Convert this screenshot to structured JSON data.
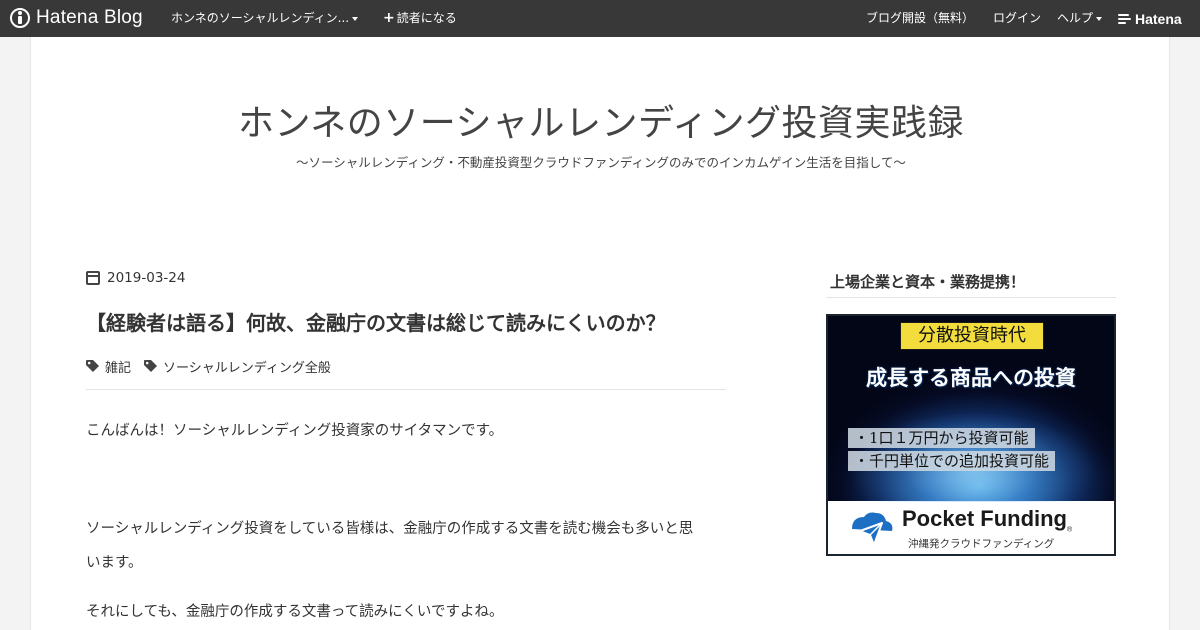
{
  "topbar": {
    "logo_text": "Hatena Blog",
    "blog_menu_label": "ホンネのソーシャルレンディン...",
    "subscribe_label": "読者になる",
    "open_blog_label": "ブログ開設（無料）",
    "login_label": "ログイン",
    "help_label": "ヘルプ",
    "hatena_label": "Hatena"
  },
  "blog": {
    "title": "ホンネのソーシャルレンディング投資実践録",
    "description": "～ソーシャルレンディング・不動産投資型クラウドファンディングのみでのインカムゲイン生活を目指して～"
  },
  "entry": {
    "date": "2019-03-24",
    "title": "【経験者は語る】何故、金融庁の文書は総じて読みにくいのか？",
    "categories": [
      "雑記",
      "ソーシャルレンディング全般"
    ],
    "paragraphs": [
      "こんばんは！ソーシャルレンディング投資家のサイタマンです。",
      "ソーシャルレンディング投資をしている皆様は、金融庁の作成する文書を読む機会も多いと思",
      "います。",
      "それにしても、金融庁の作成する文書って読みにくいですよね。"
    ]
  },
  "sidebar": {
    "title": "上場企業と資本・業務提携！",
    "banner": {
      "headline": "分散投資時代",
      "subhead": "成長する商品への投資",
      "bullets": [
        "・1口１万円から投資可能",
        "・千円単位での追加投資可能"
      ],
      "brand": "Pocket Funding",
      "brand_mark": "®",
      "tagline": "沖縄発クラウドファンディング"
    }
  },
  "colors": {
    "topbar_bg": "#383838",
    "page_bg": "#f3f3f3",
    "banner_headline_bg": "#f2dd3c",
    "pf_logo_blue": "#1d6fc4"
  }
}
